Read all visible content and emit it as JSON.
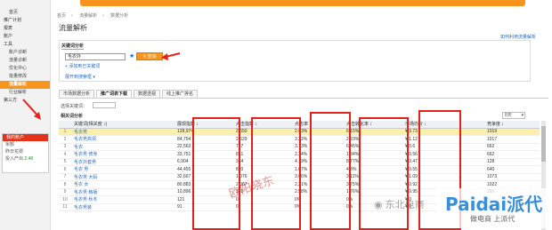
{
  "sidebar": {
    "items": [
      {
        "label": "首页",
        "type": "item"
      },
      {
        "label": "推广计划",
        "type": "group"
      },
      {
        "label": "报表",
        "type": "group"
      },
      {
        "label": "账户",
        "type": "group"
      },
      {
        "label": "工具",
        "type": "group"
      },
      {
        "label": "账户诊断",
        "type": "item"
      },
      {
        "label": "流量诊断",
        "type": "item"
      },
      {
        "label": "优化中心",
        "type": "item"
      },
      {
        "label": "批量修改",
        "type": "item"
      },
      {
        "label": "流量解析",
        "type": "active"
      },
      {
        "label": "行业解析",
        "type": "item"
      },
      {
        "label": "第三方",
        "type": "group"
      }
    ],
    "box": {
      "header": "我的账户",
      "rows": [
        {
          "label": "余额",
          "value": ""
        },
        {
          "label": "昨日花费",
          "value": ""
        },
        {
          "label": "投入产出",
          "value": "2.48"
        }
      ]
    }
  },
  "breadcrumb": [
    "首页",
    "流量解析",
    "数据分析"
  ],
  "page_title": "流量解析",
  "help_link": "如何利用流量解析",
  "keyword_panel": {
    "tab": "关键词分析",
    "input_value": "毛衣外",
    "query_button": "查询",
    "add_link": "添加到已关键词",
    "expand_link": "展开到搜索框"
  },
  "tabs": [
    "市场数据分析",
    "推广词表下载",
    "数据透视",
    "线上推广排名"
  ],
  "filter_label": "选择关键词：",
  "sub_title": "相关词分析",
  "select_value": "8天",
  "table": {
    "headers": [
      "",
      "关键词(相关度 ↕)",
      "展现指数 ↕",
      "点击指数 ↕",
      "点击率 ↕",
      "点击转化率 ↕",
      "市场均价 ↕",
      "竞争度 ↕"
    ],
    "rows": [
      [
        "1",
        "毛衣男",
        "128,974",
        "2,650",
        "2.03%",
        "6.15%",
        "¥ 3.73",
        "1919"
      ],
      [
        "2",
        "毛衣男高领",
        "84,754",
        "2,629",
        "3.22%",
        "2.23%",
        "¥ 1.12",
        "1017"
      ],
      [
        "3",
        "毛衣",
        "22,563",
        "737",
        "3.13%",
        "6.45%",
        "¥ 0.6",
        "662"
      ],
      [
        "4",
        "毛衣男 修身",
        "33,751",
        "851",
        "2.34%",
        "1.84%",
        "¥ 0.56",
        "662"
      ],
      [
        "5",
        "毛衣外套男",
        "6,904",
        "344",
        "4.19%",
        "8.77%",
        "¥ 0.47",
        "128"
      ],
      [
        "6",
        "毛衣 男",
        "44,455",
        "820",
        "1.67%",
        "4.8%",
        "¥ 0.55",
        "640"
      ],
      [
        "7",
        "毛衣男 大码",
        "32,667",
        "1,076",
        "3.06%",
        "3.11%",
        "¥ 1.09",
        "1073"
      ],
      [
        "8",
        "毛衣 女",
        "80,883",
        "2,087",
        "2.21%",
        "3.75%",
        "¥ 0.92",
        "1022"
      ],
      [
        "9",
        "毛衣男 韩版",
        "10,896",
        "302",
        "2.58%",
        "1.76%",
        "¥ 0.95",
        "289"
      ],
      [
        "10",
        "毛衣男 秋冬",
        "121",
        "0",
        "0%",
        "0%",
        "¥ 0",
        "5"
      ],
      [
        "11",
        "毛衣男装",
        "91",
        "0",
        "0%",
        "0%",
        "¥ 0",
        "0"
      ]
    ]
  },
  "watermark_text": "欧阳晓东",
  "logo_watermark": {
    "brand": "Paidai派代",
    "slogan": "做电商 上派代"
  },
  "wechat_watermark": "东北电商"
}
